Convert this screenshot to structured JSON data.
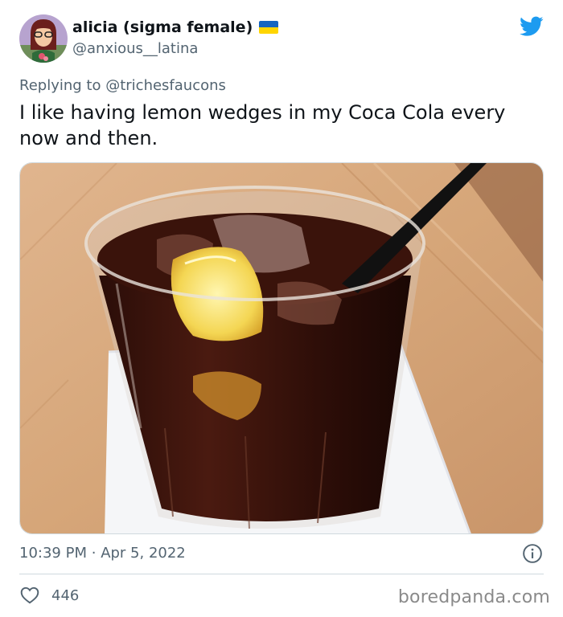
{
  "author": {
    "display_name": "alicia (sigma female)",
    "handle": "@anxious__latina",
    "avatar_icon": "cartoon-girl-avatar",
    "flag_icon": "ukraine-flag-icon"
  },
  "platform_icon": "twitter-bird-icon",
  "reply": {
    "prefix": "Replying to",
    "mention": "@trichesfaucons"
  },
  "tweet": {
    "text": "I like having lemon wedges in my Coca Cola every now and then."
  },
  "photo": {
    "subject": "glass-of-cola-with-lemon-and-straw"
  },
  "meta": {
    "time": "10:39 PM",
    "separator": "·",
    "date": "Apr 5, 2022"
  },
  "stats": {
    "likes": "446"
  },
  "watermark": "boredpanda.com",
  "colors": {
    "text": "#0f1419",
    "secondary": "#536471",
    "twitter_blue": "#1d9bf0",
    "divider": "#cfd9de"
  }
}
